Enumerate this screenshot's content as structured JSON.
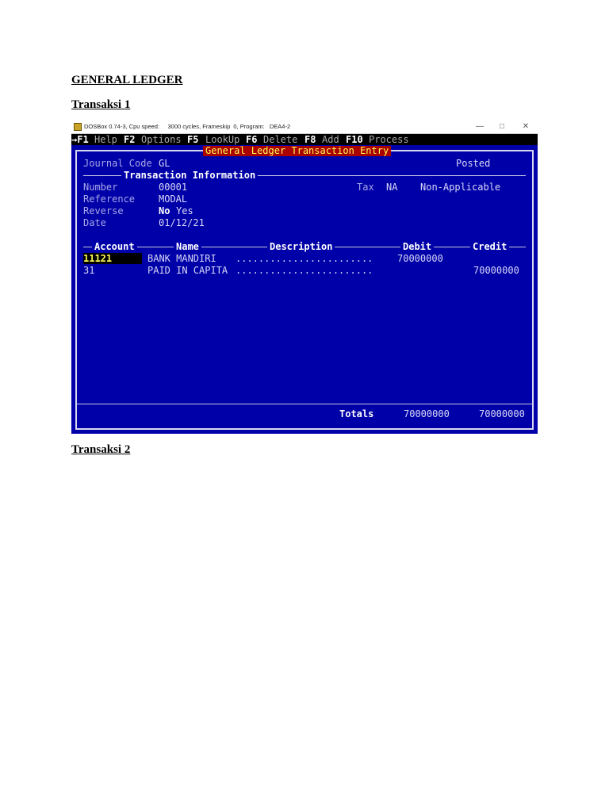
{
  "document": {
    "heading": "GENERAL LEDGER",
    "section1": "Transaksi 1",
    "section2": "Transaksi 2"
  },
  "titlebar": {
    "text": "DOSBox 0.74-3, Cpu speed:     3000 cycles, Frameskip  0, Program:   DEA4-2",
    "minimize": "—",
    "maximize": "□",
    "close": "✕"
  },
  "menu": {
    "items": [
      {
        "key": "→F1",
        "label": "Help"
      },
      {
        "key": "F2",
        "label": "Options"
      },
      {
        "key": "F5",
        "label": "LookUp"
      },
      {
        "key": "F6",
        "label": "Delete"
      },
      {
        "key": "F8",
        "label": "Add"
      },
      {
        "key": "F10",
        "label": "Process"
      }
    ]
  },
  "form": {
    "window_title": "General Ledger Transaction Entry",
    "journal_code_label": "Journal Code",
    "journal_code": "GL",
    "status": "Posted",
    "section_title": "Transaction Information",
    "number_label": "Number",
    "number": "00001",
    "reference_label": "Reference",
    "reference": "MODAL",
    "reverse_label": "Reverse",
    "reverse_no": "No",
    "reverse_yes": "Yes",
    "date_label": "Date",
    "date": "01/12/21",
    "tax_label": "Tax",
    "tax_code": "NA",
    "tax_desc": "Non-Applicable"
  },
  "table": {
    "columns": {
      "account": "Account",
      "name": "Name",
      "description": "Description",
      "debit": "Debit",
      "credit": "Credit"
    },
    "rows": [
      {
        "account": "11121",
        "name": "BANK MANDIRI",
        "description": "........................",
        "debit": "70000000",
        "credit": ""
      },
      {
        "account": "31",
        "name": "PAID IN CAPITA",
        "description": "........................",
        "debit": "",
        "credit": "70000000"
      }
    ]
  },
  "totals": {
    "label": "Totals",
    "debit": "70000000",
    "credit": "70000000"
  },
  "colors": {
    "screen_bg": "#0000a8",
    "title_bg": "#aa0000",
    "title_fg": "#ffff55",
    "highlight_fg": "#ffff55"
  }
}
